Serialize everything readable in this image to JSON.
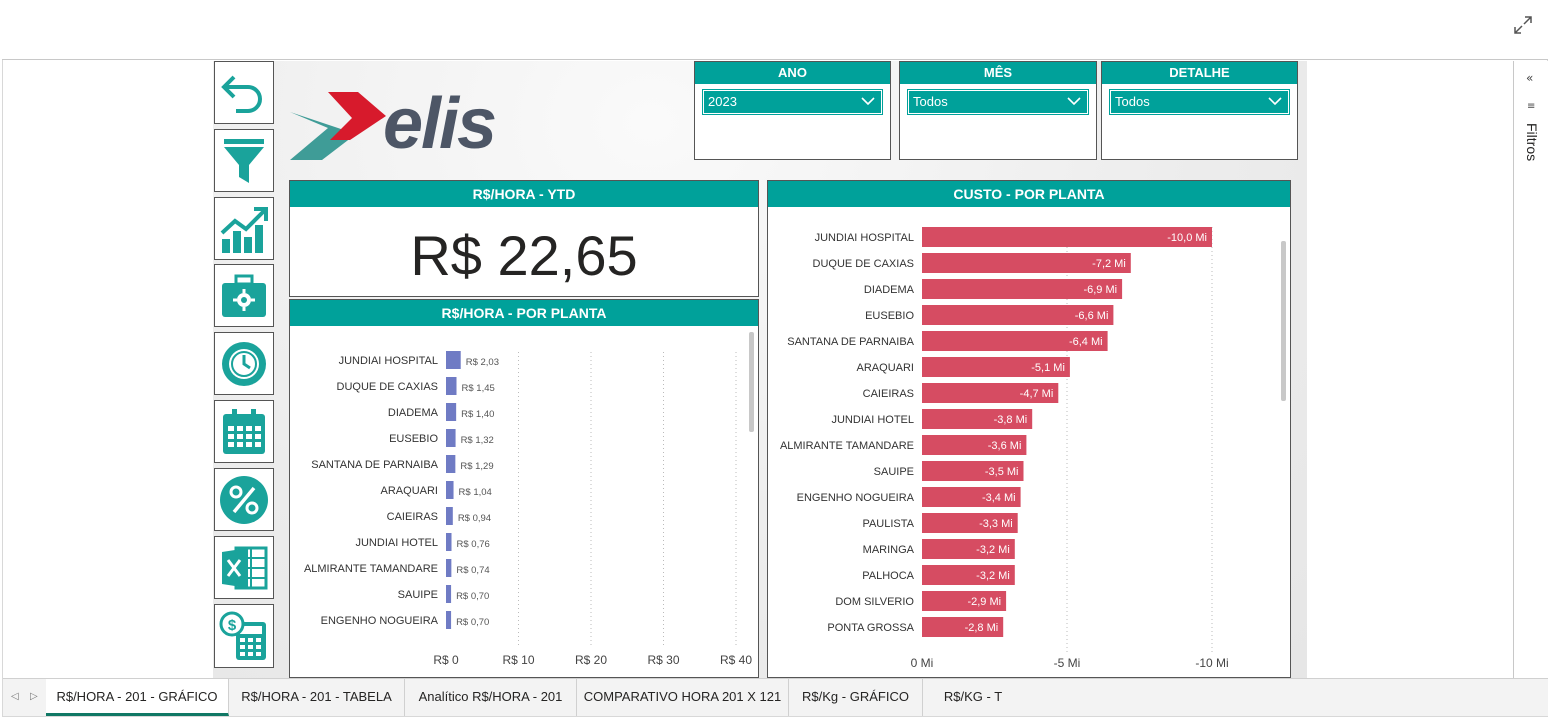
{
  "filters_pane": {
    "label": "Filtros",
    "collapse_icon": "chevron-double-left-icon"
  },
  "logo": {
    "text": "elis"
  },
  "slicers": [
    {
      "title": "ANO",
      "value": "2023"
    },
    {
      "title": "MÊS",
      "value": "Todos"
    },
    {
      "title": "DETALHE",
      "value": "Todos"
    }
  ],
  "nav_buttons": [
    "back-arrow-icon",
    "funnel-icon",
    "growth-chart-icon",
    "toolbox-gear-icon",
    "clock-gear-icon",
    "calendar-icon",
    "percent-icon",
    "excel-icon",
    "calculator-money-icon"
  ],
  "kpi": {
    "title": "R$/HORA - YTD",
    "value": "R$ 22,65"
  },
  "colors": {
    "accent": "#00a19a",
    "bar_blue": "#6f7bc4",
    "bar_red": "#d64c62"
  },
  "chart_data": [
    {
      "type": "bar",
      "title": "R$/HORA - POR PLANTA",
      "orientation": "horizontal",
      "categories": [
        "JUNDIAI HOSPITAL",
        "DUQUE DE CAXIAS",
        "DIADEMA",
        "EUSEBIO",
        "SANTANA DE PARNAIBA",
        "ARAQUARI",
        "CAIEIRAS",
        "JUNDIAI HOTEL",
        "ALMIRANTE TAMANDARE",
        "SAUIPE",
        "ENGENHO NOGUEIRA"
      ],
      "values": [
        2.03,
        1.45,
        1.4,
        1.32,
        1.29,
        1.04,
        0.94,
        0.76,
        0.74,
        0.7,
        0.7
      ],
      "labels": [
        "R$ 2,03",
        "R$ 1,45",
        "R$ 1,40",
        "R$ 1,32",
        "R$ 1,29",
        "R$ 1,04",
        "R$ 0,94",
        "R$ 0,76",
        "R$ 0,74",
        "R$ 0,70",
        "R$ 0,70"
      ],
      "xlim": [
        0,
        40
      ],
      "xticks": [
        "R$ 0",
        "R$ 10",
        "R$ 20",
        "R$ 30",
        "R$ 40"
      ],
      "grid": true
    },
    {
      "type": "bar",
      "title": "CUSTO - POR PLANTA",
      "orientation": "horizontal",
      "categories": [
        "JUNDIAI HOSPITAL",
        "DUQUE DE CAXIAS",
        "DIADEMA",
        "EUSEBIO",
        "SANTANA DE PARNAIBA",
        "ARAQUARI",
        "CAIEIRAS",
        "JUNDIAI HOTEL",
        "ALMIRANTE TAMANDARE",
        "SAUIPE",
        "ENGENHO NOGUEIRA",
        "PAULISTA",
        "MARINGA",
        "PALHOCA",
        "DOM SILVERIO",
        "PONTA GROSSA"
      ],
      "values": [
        -10.0,
        -7.2,
        -6.9,
        -6.6,
        -6.4,
        -5.1,
        -4.7,
        -3.8,
        -3.6,
        -3.5,
        -3.4,
        -3.3,
        -3.2,
        -3.2,
        -2.9,
        -2.8
      ],
      "labels": [
        "-10,0 Mi",
        "-7,2 Mi",
        "-6,9 Mi",
        "-6,6 Mi",
        "-6,4 Mi",
        "-5,1 Mi",
        "-4,7 Mi",
        "-3,8 Mi",
        "-3,6 Mi",
        "-3,5 Mi",
        "-3,4 Mi",
        "-3,3 Mi",
        "-3,2 Mi",
        "-3,2 Mi",
        "-2,9 Mi",
        "-2,8 Mi"
      ],
      "xlim": [
        0,
        -10
      ],
      "xticks": [
        "0 Mi",
        "-5 Mi",
        "-10 Mi"
      ],
      "grid": true
    }
  ],
  "tabs": [
    {
      "label": "R$/HORA - 201 - GRÁFICO",
      "active": true
    },
    {
      "label": "R$/HORA - 201 - TABELA",
      "active": false
    },
    {
      "label": "Analítico R$/HORA - 201",
      "active": false
    },
    {
      "label": "COMPARATIVO HORA 201 X 121",
      "active": false
    },
    {
      "label": "R$/Kg - GRÁFICO",
      "active": false
    },
    {
      "label": "R$/KG - T",
      "active": false
    }
  ]
}
